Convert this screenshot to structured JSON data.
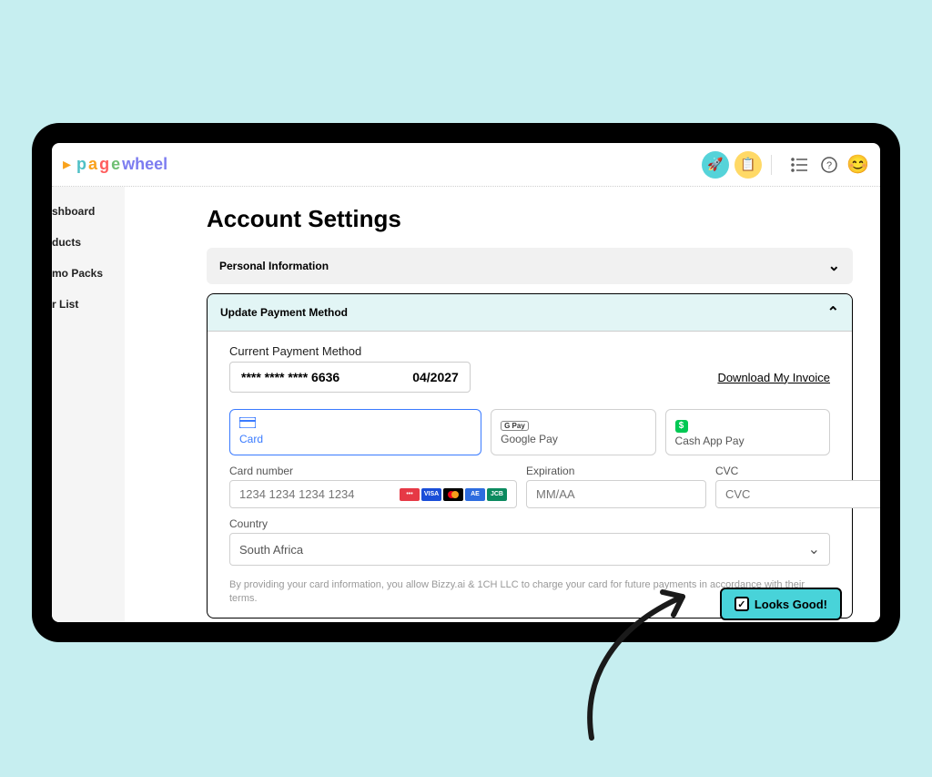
{
  "logo": {
    "p": "p",
    "a": "a",
    "g": "g",
    "e": "e",
    "wheel": "wheel"
  },
  "topbar": {
    "rocket": "🚀",
    "tablet": "📋",
    "list": "≡",
    "help": "?",
    "smile": "😊"
  },
  "sidebar": {
    "items": [
      "shboard",
      "ducts",
      "mo Packs",
      "r List"
    ]
  },
  "page": {
    "title": "Account Settings"
  },
  "acc1": {
    "title": "Personal Information"
  },
  "acc2": {
    "title": "Update Payment Method",
    "current_label": "Current Payment Method",
    "masked": "**** **** **** 6636",
    "exp": "04/2027",
    "download": "Download My Invoice",
    "opts": {
      "card": "Card",
      "gpay": "Google Pay",
      "gpay_badge": "G Pay",
      "cash": "Cash App Pay",
      "cash_badge": "$"
    },
    "card_number_label": "Card number",
    "card_number_ph": "1234 1234 1234 1234",
    "exp_label": "Expiration",
    "exp_ph": "MM/AA",
    "cvc_label": "CVC",
    "cvc_ph": "CVC",
    "country_label": "Country",
    "country_value": "South Africa",
    "disclaimer": "By providing your card information, you allow Bizzy.ai & 1CH LLC to charge your card for future payments in accordance with their terms.",
    "looks_good": "Looks Good!",
    "check": "✓"
  },
  "chevdown": "⌄",
  "chevup": "⌃",
  "cc_brands": [
    "•••",
    "VISA",
    "MC",
    "AE",
    "JCB"
  ]
}
